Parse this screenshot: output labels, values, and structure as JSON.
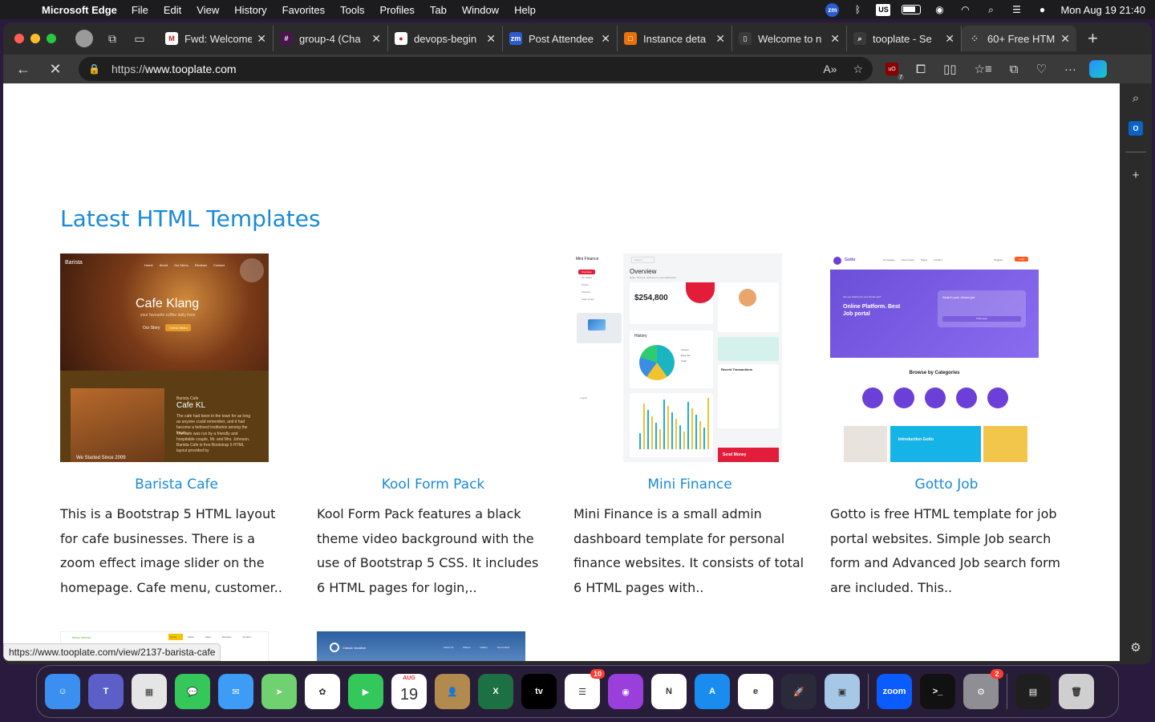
{
  "menubar": {
    "app_name": "Microsoft Edge",
    "items": [
      "File",
      "Edit",
      "View",
      "History",
      "Favorites",
      "Tools",
      "Profiles",
      "Tab",
      "Window",
      "Help"
    ],
    "status_icons": [
      "zoom-icon",
      "bluetooth-icon",
      "input-us-icon",
      "battery-icon",
      "user-icon",
      "wifi-icon",
      "search-icon",
      "control-center-icon",
      "siri-icon"
    ],
    "keyboard_label": "US",
    "zoom_label": "zm",
    "datetime": "Mon Aug 19  21:40"
  },
  "tabs": [
    {
      "title": "Fwd: Welcome",
      "favicon": "gmail-icon",
      "color": "#ffffff",
      "glyph": "M"
    },
    {
      "title": "group-4 (Cha",
      "favicon": "slack-icon",
      "color": "#4a154b",
      "glyph": "#"
    },
    {
      "title": "devops-begin",
      "favicon": "github-icon",
      "color": "#ffffff",
      "glyph": "●"
    },
    {
      "title": "Post Attendee",
      "favicon": "zoom-icon",
      "color": "#2d5ccf",
      "glyph": "zm"
    },
    {
      "title": "Instance deta",
      "favicon": "aws-icon",
      "color": "#e8730c",
      "glyph": "□"
    },
    {
      "title": "Welcome to n",
      "favicon": "document-icon",
      "color": "#3a3a3a",
      "glyph": "▯"
    },
    {
      "title": "tooplate - Se",
      "favicon": "search-icon",
      "color": "#3a3a3a",
      "glyph": "⌕"
    },
    {
      "title": "60+ Free HTM",
      "favicon": "loading-icon",
      "color": "#3a3a3a",
      "glyph": "⁘",
      "active": true
    }
  ],
  "address": {
    "scheme": "https://",
    "host": "www.tooplate.com",
    "extension_badge": "7",
    "ublock_label": "uO"
  },
  "page": {
    "section_title": "Latest HTML Templates",
    "cards": [
      {
        "name": "Barista Cafe",
        "desc": "This is a Bootstrap 5 HTML layout for cafe businesses. There is a zoom effect image slider on the homepage. Cafe menu, customer..",
        "thumb": "barista",
        "art": {
          "brand": "Barista",
          "nav": [
            "Home",
            "About",
            "Our Menu",
            "Reviews",
            "Contact"
          ],
          "hero_title": "Cafe Klang",
          "hero_sub": "your favourite coffee daily lives",
          "btn1": "Our Story",
          "btn2": "Check Menu",
          "section_kicker": "Barista Cafe",
          "section_title": "Cafe KL",
          "para1": "The cafe had been in the town for as long as anyone could remember, and it had become a beloved institution among the locals.",
          "para2": "The cafe was run by a friendly and hospitable couple, Mr. and Mrs. Johnson. Barista Cafe is free Bootstrap 5 HTML layout provided by",
          "since": "We Started Since 2009"
        }
      },
      {
        "name": "Kool Form Pack",
        "desc": "Kool Form Pack features a black theme video background with the use of Bootstrap 5 CSS. It includes 6 HTML pages for login,..",
        "thumb": "kool"
      },
      {
        "name": "Mini Finance",
        "desc": "Mini Finance is a small admin dashboard template for personal finance websites. It consists of total 6 HTML pages with..",
        "thumb": "mini",
        "art": {
          "brand": "Mini Finance",
          "search": "Search",
          "overview": "Overview",
          "welcome": "Hello, Thomas, welcome to your dashboard",
          "balance": "$254,800",
          "history": "History",
          "recent": "Recent Transactions",
          "send": "Send Money",
          "nav": [
            "Overview",
            "My Wallet",
            "Profile",
            "Settings",
            "Help Center"
          ],
          "logout": "Logout",
          "legend": [
            "Income",
            "Expense",
            "Cash"
          ]
        }
      },
      {
        "name": "Gotto Job",
        "desc": "Gotto is free HTML template for job portal websites. Simple Job search form and Advanced Job search form are included. This..",
        "thumb": "gotto",
        "art": {
          "brand": "Gotto",
          "hero_kicker": "Are you looking for your dream job?",
          "hero_title": "Online Platform. Best Job portal",
          "search_title": "Search your dream job",
          "categories": "Browse by Categories",
          "intro": "Introduction Gotto",
          "login": "Login",
          "register": "Register",
          "nav": [
            "Homepage",
            "About Gotto",
            "Pages",
            "Contact"
          ],
          "find": "Find a job"
        }
      }
    ],
    "next_row": [
      {
        "brand": "Moso Interior",
        "nav": [
          "Home",
          "About",
          "Shop",
          "Reviews",
          "Contact"
        ]
      },
      {
        "brand": "Classic Vacation",
        "nav": [
          "About Us",
          "Places",
          "Gallery",
          "Get contact"
        ]
      }
    ],
    "status_url": "https://www.tooplate.com/view/2137-barista-cafe"
  },
  "dock": {
    "apps": [
      {
        "name": "finder",
        "color": "#3b8ff0",
        "glyph": "☺"
      },
      {
        "name": "teams",
        "color": "#5b5fc7",
        "glyph": "T"
      },
      {
        "name": "launchpad",
        "color": "#e5e5e5",
        "glyph": "▦"
      },
      {
        "name": "messages",
        "color": "#34c759",
        "glyph": "💬"
      },
      {
        "name": "mail",
        "color": "#3d9cf5",
        "glyph": "✉"
      },
      {
        "name": "maps",
        "color": "#6fd16f",
        "glyph": "➤"
      },
      {
        "name": "photos",
        "color": "#ffffff",
        "glyph": "✿"
      },
      {
        "name": "facetime",
        "color": "#34c759",
        "glyph": "▶"
      },
      {
        "name": "calendar",
        "color": "#ffffff",
        "glyph": "19",
        "sub": "AUG"
      },
      {
        "name": "contacts",
        "color": "#b38a4e",
        "glyph": "👤"
      },
      {
        "name": "excel",
        "color": "#1d7044",
        "glyph": "X"
      },
      {
        "name": "apple-tv",
        "color": "#000000",
        "glyph": "tv"
      },
      {
        "name": "reminders",
        "color": "#ffffff",
        "glyph": "☰",
        "badge": "10"
      },
      {
        "name": "podcasts",
        "color": "#9b3fdc",
        "glyph": "◉"
      },
      {
        "name": "news",
        "color": "#ffffff",
        "glyph": "N"
      },
      {
        "name": "app-store",
        "color": "#1a8cf0",
        "glyph": "A"
      },
      {
        "name": "edge",
        "color": "#ffffff",
        "glyph": "e"
      },
      {
        "name": "rocket",
        "color": "#2a2a3a",
        "glyph": "🚀"
      },
      {
        "name": "preview",
        "color": "#a7c7e7",
        "glyph": "▣"
      },
      {
        "name": "zoom",
        "color": "#0b5cff",
        "glyph": "zoom"
      },
      {
        "name": "terminal",
        "color": "#111111",
        "glyph": ">_"
      },
      {
        "name": "system-settings",
        "color": "#8e8e93",
        "glyph": "⚙",
        "badge": "2"
      },
      {
        "name": "downloads",
        "color": "#1f1f1f",
        "glyph": "▤"
      },
      {
        "name": "trash",
        "color": "#cfcfcf",
        "glyph": "🗑"
      }
    ]
  }
}
